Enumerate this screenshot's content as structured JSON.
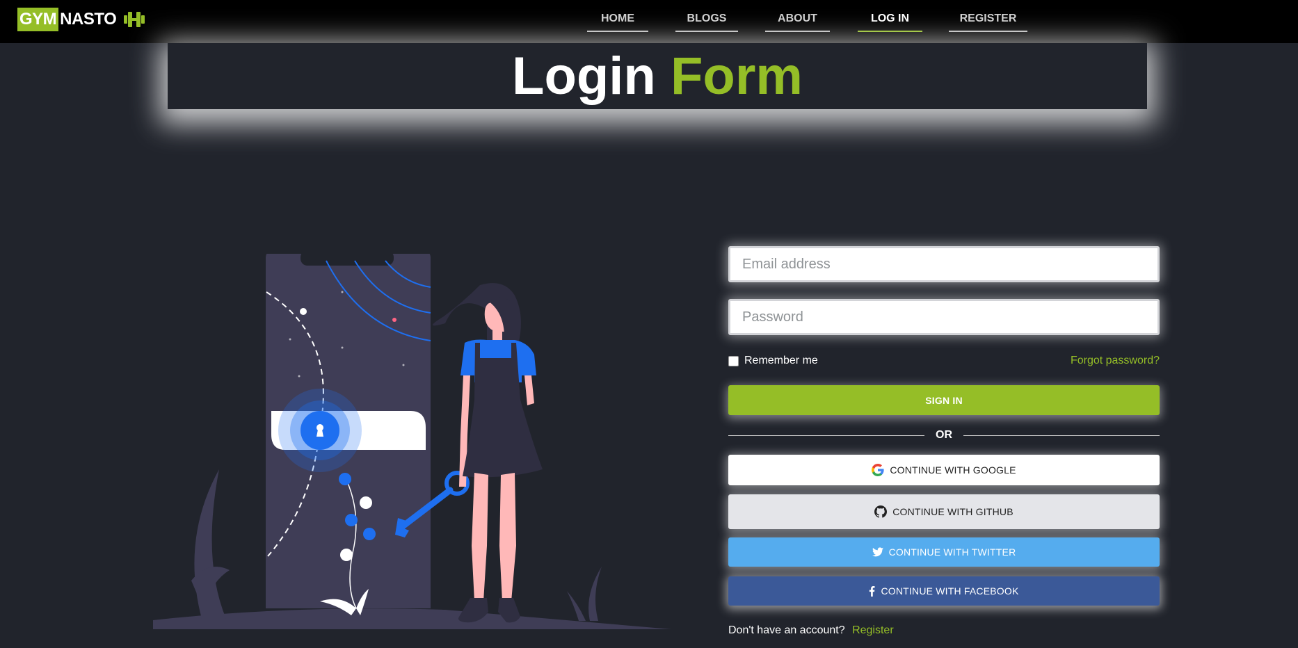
{
  "brand": {
    "part1": "GYM",
    "part2": "NASTO",
    "icon": "dumbbell-icon",
    "accent": "#95be27"
  },
  "nav": {
    "items": [
      {
        "label": "HOME",
        "active": false
      },
      {
        "label": "BLOGS",
        "active": false
      },
      {
        "label": "ABOUT",
        "active": false
      },
      {
        "label": "LOG IN",
        "active": true
      },
      {
        "label": "REGISTER",
        "active": false
      }
    ]
  },
  "page_title": {
    "white": "Login",
    "green": "Form"
  },
  "form": {
    "email_placeholder": "Email address",
    "password_placeholder": "Password",
    "remember_label": "Remember me",
    "forgot_label": "Forgot password?",
    "signin_label": "SIGN IN",
    "or_label": "OR",
    "google_label": "CONTINUE WITH GOOGLE",
    "github_label": "CONTINUE WITH GITHUB",
    "twitter_label": "CONTINUE WITH TWITTER",
    "facebook_label": "CONTINUE WITH FACEBOOK",
    "no_account_text": "Don't have an account?",
    "register_link": "Register"
  },
  "colors": {
    "background": "#21242c",
    "accent": "#95be27",
    "twitter": "#55acee",
    "facebook": "#3b5998",
    "illustration_primary": "#1e6ff0"
  }
}
